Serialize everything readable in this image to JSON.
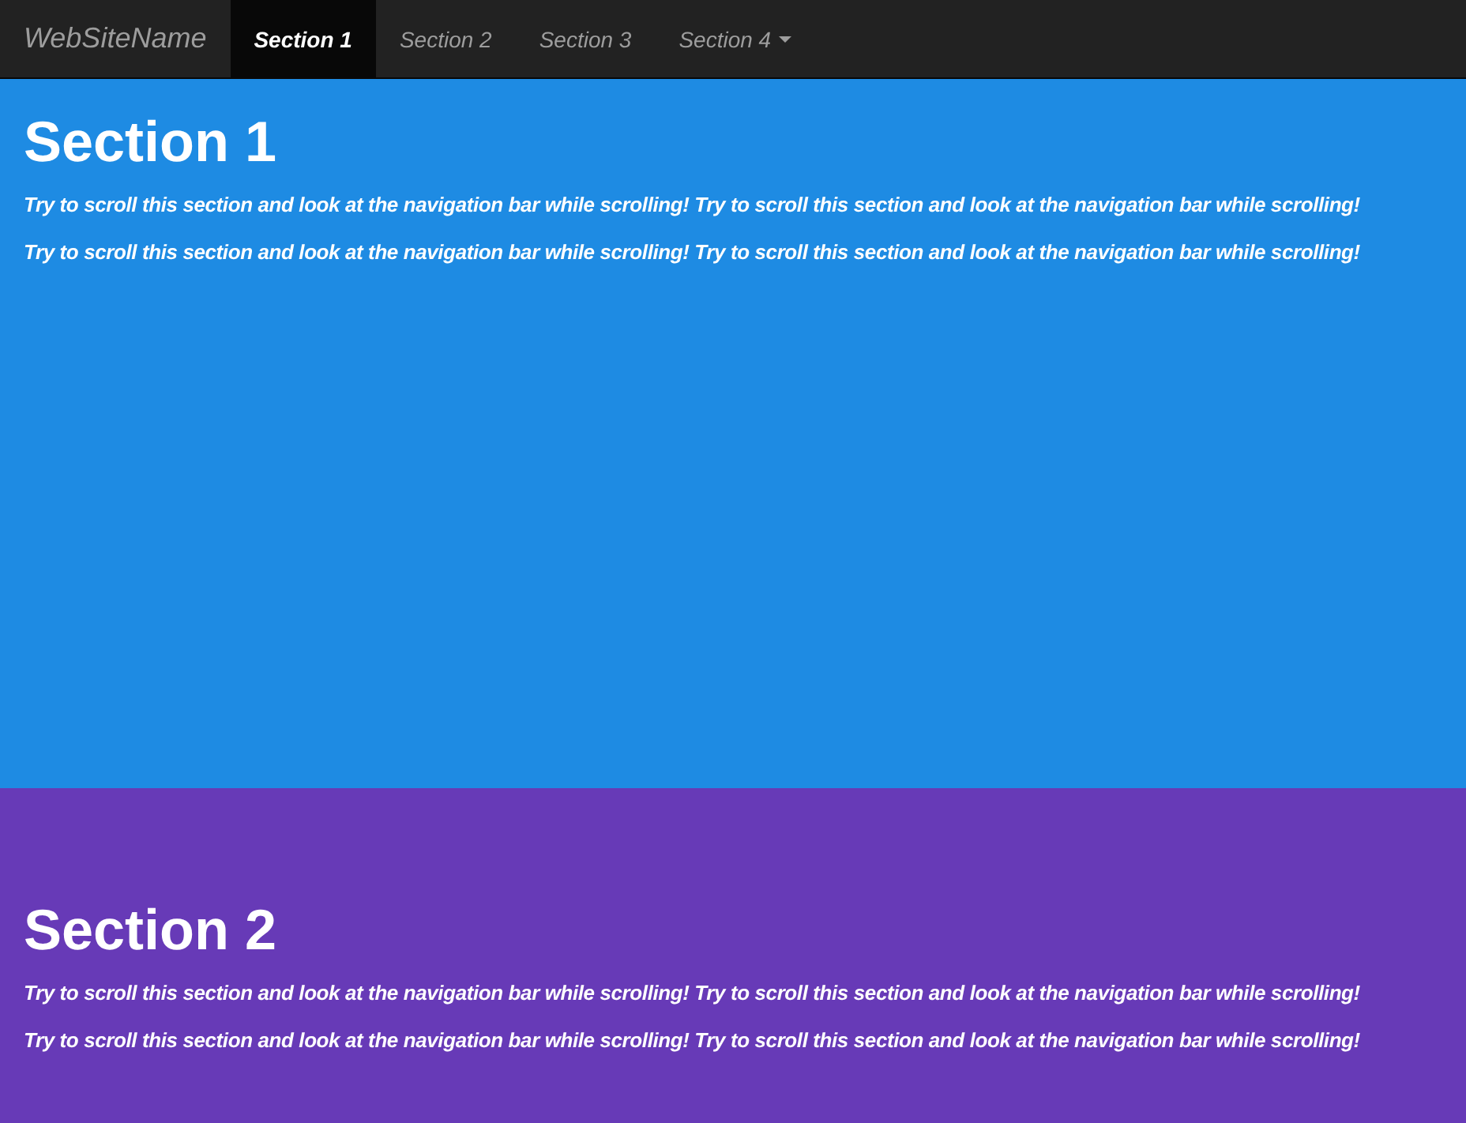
{
  "navbar": {
    "brand": "WebSiteName",
    "items": [
      {
        "label": "Section 1",
        "selected": true,
        "kind": "link"
      },
      {
        "label": "Section 2",
        "selected": false,
        "kind": "link"
      },
      {
        "label": "Section 3",
        "selected": false,
        "kind": "link"
      },
      {
        "label": "Section 4",
        "selected": false,
        "kind": "dropdown"
      }
    ]
  },
  "sections": [
    {
      "title": "Section 1",
      "color": "#1e8be3",
      "paragraphs": [
        "Try to scroll this section and look at the navigation bar while scrolling! Try to scroll this section and look at the navigation bar while scrolling!",
        "Try to scroll this section and look at the navigation bar while scrolling! Try to scroll this section and look at the navigation bar while scrolling!"
      ]
    },
    {
      "title": "Section 2",
      "color": "#673ab7",
      "paragraphs": [
        "Try to scroll this section and look at the navigation bar while scrolling! Try to scroll this section and look at the navigation bar while scrolling!",
        "Try to scroll this section and look at the navigation bar while scrolling! Try to scroll this section and look at the navigation bar while scrolling!"
      ]
    }
  ]
}
